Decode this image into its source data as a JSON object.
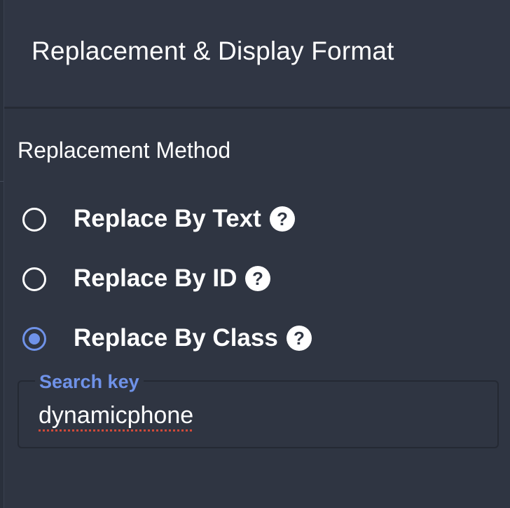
{
  "header": {
    "title": "Replacement & Display Format"
  },
  "replacement_method": {
    "title": "Replacement Method",
    "options": [
      {
        "label": "Replace By Text",
        "selected": false,
        "icon": "help-icon"
      },
      {
        "label": "Replace By ID",
        "selected": false,
        "icon": "help-icon"
      },
      {
        "label": "Replace By Class",
        "selected": true,
        "icon": "help-icon"
      }
    ]
  },
  "search_key": {
    "label": "Search key",
    "value": "dynamicphone"
  },
  "colors": {
    "background": "#2f3542",
    "accent": "#6f92e8",
    "spellcheck_underline": "#d04a3a"
  }
}
